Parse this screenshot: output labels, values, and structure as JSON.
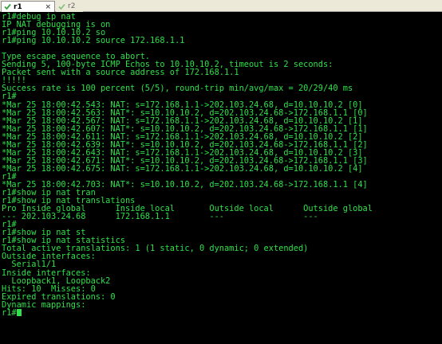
{
  "tabs": [
    {
      "label": "r1",
      "close": "×",
      "active": true
    },
    {
      "label": "r2",
      "active": false
    }
  ],
  "colors": {
    "terminal_bg": "#000000",
    "terminal_fg": "#2ee04a",
    "tab_check": "#3aa23a"
  },
  "terminal": {
    "lines": [
      "r1#debug ip nat",
      "IP NAT debugging is on",
      "r1#ping 10.10.10.2 so",
      "r1#ping 10.10.10.2 source 172.168.1.1",
      "",
      "Type escape sequence to abort.",
      "Sending 5, 100-byte ICMP Echos to 10.10.10.2, timeout is 2 seconds:",
      "Packet sent with a source address of 172.168.1.1",
      "!!!!!",
      "Success rate is 100 percent (5/5), round-trip min/avg/max = 20/29/40 ms",
      "r1#",
      "*Mar 25 18:00:42.543: NAT: s=172.168.1.1->202.103.24.68, d=10.10.10.2 [0]",
      "*Mar 25 18:00:42.563: NAT*: s=10.10.10.2, d=202.103.24.68->172.168.1.1 [0]",
      "*Mar 25 18:00:42.567: NAT: s=172.168.1.1->202.103.24.68, d=10.10.10.2 [1]",
      "*Mar 25 18:00:42.607: NAT*: s=10.10.10.2, d=202.103.24.68->172.168.1.1 [1]",
      "*Mar 25 18:00:42.611: NAT: s=172.168.1.1->202.103.24.68, d=10.10.10.2 [2]",
      "*Mar 25 18:00:42.639: NAT*: s=10.10.10.2, d=202.103.24.68->172.168.1.1 [2]",
      "*Mar 25 18:00:42.643: NAT: s=172.168.1.1->202.103.24.68, d=10.10.10.2 [3]",
      "*Mar 25 18:00:42.671: NAT*: s=10.10.10.2, d=202.103.24.68->172.168.1.1 [3]",
      "*Mar 25 18:00:42.675: NAT: s=172.168.1.1->202.103.24.68, d=10.10.10.2 [4]",
      "r1#",
      "*Mar 25 18:00:42.703: NAT*: s=10.10.10.2, d=202.103.24.68->172.168.1.1 [4]",
      "r1#show ip nat tran",
      "r1#show ip nat translations",
      "Pro Inside global      Inside local       Outside local      Outside global",
      "--- 202.103.24.68      172.168.1.1        ---                ---",
      "r1#",
      "r1#show ip nat st",
      "r1#show ip nat statistics",
      "Total active translations: 1 (1 static, 0 dynamic; 0 extended)",
      "Outside interfaces:",
      "  Serial1/1",
      "Inside interfaces:",
      "  Loopback1, Loopback2",
      "Hits: 10  Misses: 0",
      "Expired translations: 0",
      "Dynamic mappings:",
      "r1#"
    ]
  }
}
